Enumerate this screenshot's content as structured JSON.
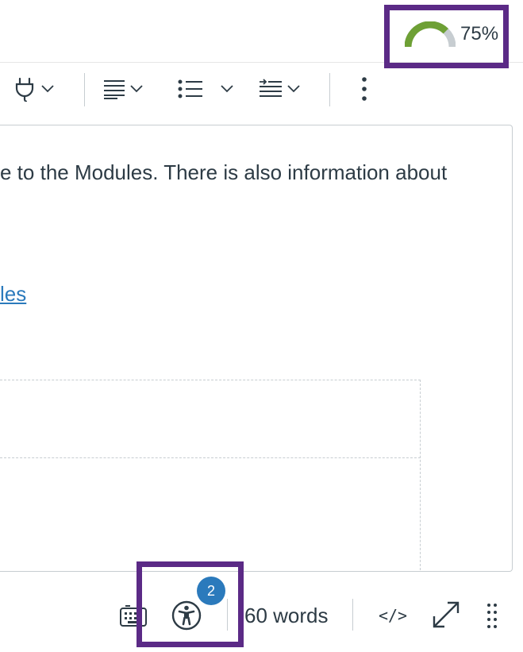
{
  "header": {
    "score": "75%",
    "score_level": 0.75,
    "score_color": "#6ea035"
  },
  "toolbar": {
    "items": [
      {
        "icon": "plug-icon"
      },
      {
        "icon": "align-icon"
      },
      {
        "icon": "list-icon"
      },
      {
        "icon": "indent-icon"
      },
      {
        "icon": "more-icon"
      }
    ]
  },
  "editor": {
    "paragraph": "e to the Modules. There is also information about",
    "link_text": "les"
  },
  "statusbar": {
    "a11y_issue_count": "2",
    "word_count": "60 words",
    "code_label": "</>"
  },
  "colors": {
    "highlight": "#5b2a86",
    "accent": "#2b7abc",
    "gauge_track": "#c7cdd1"
  }
}
